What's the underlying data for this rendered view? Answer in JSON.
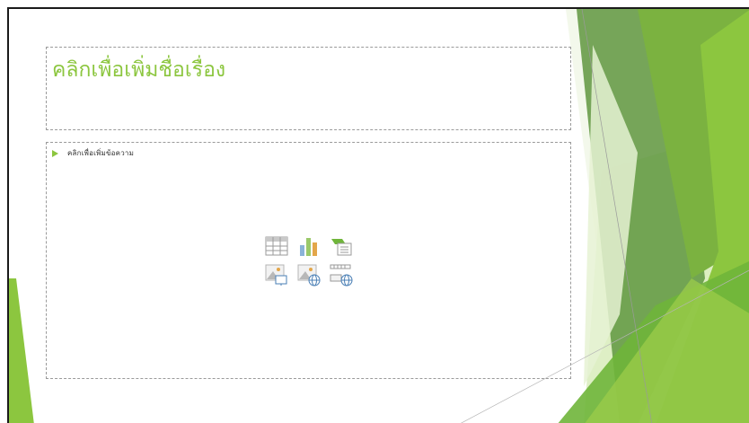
{
  "slide": {
    "title_placeholder": "คลิกเพื่อเพิ่มชื่อเรื่อง",
    "content_placeholder": "คลิกเพื่อเพิ่มข้อความ"
  },
  "insert_icons": [
    "table-icon",
    "chart-icon",
    "smartart-icon",
    "picture-icon",
    "online-picture-icon",
    "video-icon"
  ],
  "theme": {
    "accent": "#8cc63f",
    "accent_dark": "#5a9e3a",
    "accent_light": "#d4e8b6"
  }
}
